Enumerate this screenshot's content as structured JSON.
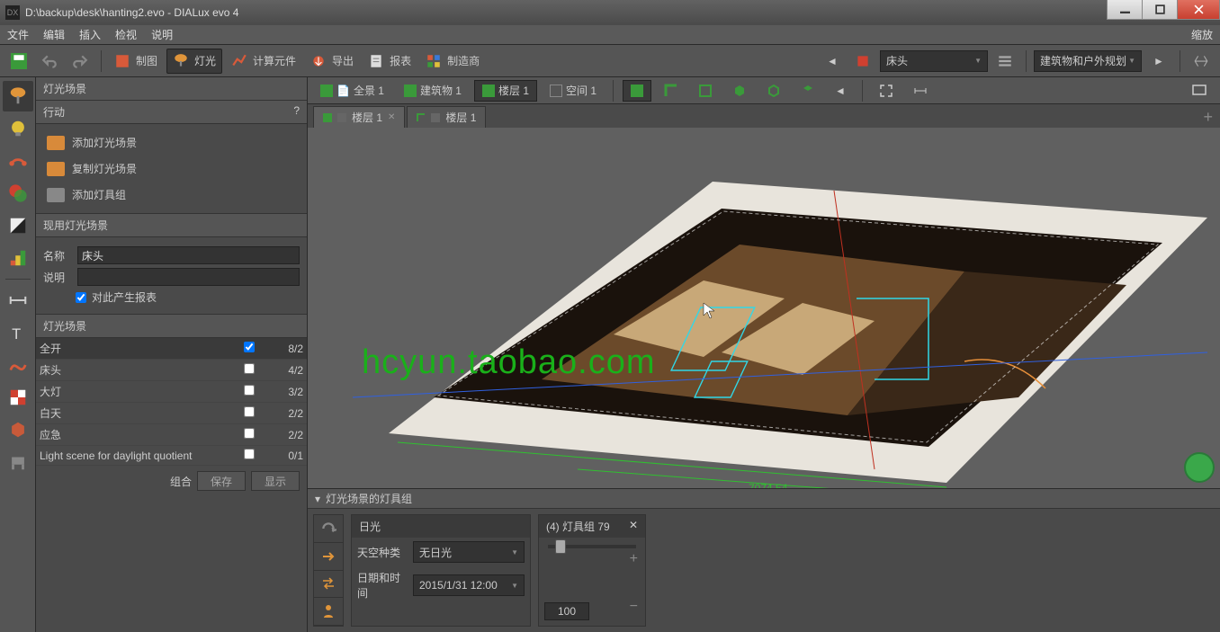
{
  "window": {
    "title": "D:\\backup\\desk\\hanting2.evo - DIALux evo 4",
    "app_icon_text": "DX"
  },
  "menu": {
    "file": "文件",
    "edit": "编辑",
    "insert": "插入",
    "view": "检视",
    "help": "说明",
    "zoom": "缩放"
  },
  "toolbar": {
    "save": "",
    "draw": "制图",
    "light": "灯光",
    "calc": "计算元件",
    "export": "导出",
    "report": "报表",
    "manufacturer": "制造商",
    "scene_select": "床头",
    "mode_select": "建筑物和户外规划"
  },
  "rail": {
    "tools": [
      "lamp",
      "bulb",
      "move",
      "palette",
      "contrast",
      "levels",
      "dimension",
      "text",
      "curve",
      "swatches",
      "box",
      "furniture"
    ]
  },
  "panel": {
    "hd": "灯光场景",
    "actions_hd": "行动",
    "actions": [
      "添加灯光场景",
      "复制灯光场景",
      "添加灯具组"
    ],
    "current_hd": "现用灯光场景",
    "name_lbl": "名称",
    "name_val": "床头",
    "desc_lbl": "说明",
    "desc_val": "",
    "gen_report": "对此产生报表",
    "list_hd": "灯光场景",
    "scenes": [
      {
        "name": "全开",
        "checked": true,
        "count": "8/2"
      },
      {
        "name": "床头",
        "checked": false,
        "count": "4/2"
      },
      {
        "name": "大灯",
        "checked": false,
        "count": "3/2"
      },
      {
        "name": "白天",
        "checked": false,
        "count": "2/2"
      },
      {
        "name": "应急",
        "checked": false,
        "count": "2/2"
      },
      {
        "name": "Light scene for daylight quotient",
        "checked": false,
        "count": "0/1"
      }
    ],
    "group_lbl": "组合",
    "save_btn": "保存",
    "show_btn": "显示"
  },
  "viewbar": {
    "items": [
      {
        "icon": "scene",
        "label": "全景 1"
      },
      {
        "icon": "building",
        "label": "建筑物 1"
      },
      {
        "icon": "floor",
        "label": "楼层 1",
        "sel": true
      },
      {
        "icon": "room",
        "label": "空间 1"
      }
    ]
  },
  "tabs": [
    {
      "label": "楼层 1",
      "active": true,
      "closable": true
    },
    {
      "label": "楼层 1",
      "active": false,
      "closable": false
    }
  ],
  "watermark": "hcyun.taobao.com",
  "bottom": {
    "hd": "灯光场景的灯具组",
    "daylight": {
      "title": "日光",
      "sky_lbl": "天空种类",
      "sky_val": "无日光",
      "date_lbl": "日期和时间",
      "date_val": "2015/1/31 12:00"
    },
    "group": {
      "title": "(4) 灯具组 79",
      "value": "100"
    }
  }
}
